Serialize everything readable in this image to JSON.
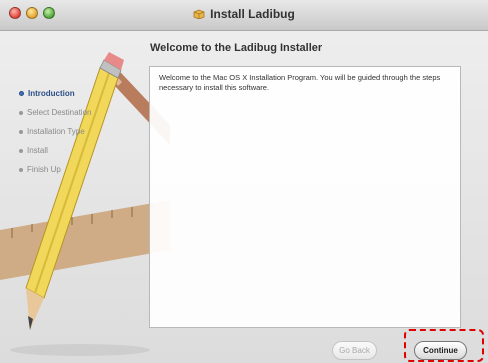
{
  "window": {
    "title": "Install Ladibug"
  },
  "heading": "Welcome to the Ladibug Installer",
  "body": "Welcome to the Mac OS X Installation Program. You will be guided through the steps necessary to install this software.",
  "steps": [
    {
      "label": "Introduction",
      "active": true
    },
    {
      "label": "Select Destination",
      "active": false
    },
    {
      "label": "Installation Type",
      "active": false
    },
    {
      "label": "Install",
      "active": false
    },
    {
      "label": "Finish Up",
      "active": false
    }
  ],
  "buttons": {
    "go_back": "Go Back",
    "continue": "Continue"
  },
  "colors": {
    "active_step": "#2d4f87",
    "highlight": "#e00000"
  }
}
